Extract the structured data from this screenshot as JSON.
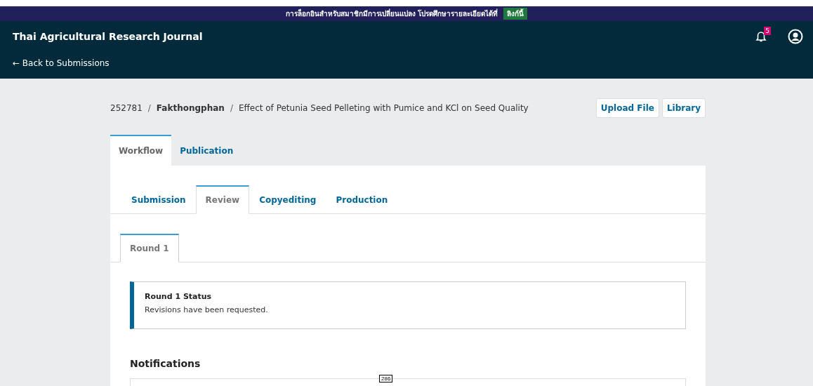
{
  "banner": {
    "text": "การล็อกอินสำหรับสมาชิกมีการเปลี่ยนแปลง โปรดศึกษารายละเอียดได้ที่",
    "link": "ลิงก์นี้"
  },
  "header": {
    "title": "Thai Agricultural Research Journal",
    "back_link": "← Back to Submissions",
    "notification_count": "5"
  },
  "breadcrumb": {
    "id": "252781",
    "separators": [
      "/",
      "/"
    ],
    "author": "Fakthongphan",
    "title": "Effect of Petunia Seed Pelleting with Pumice and KCl on Seed Quality"
  },
  "actions": [
    "Upload File",
    "Library"
  ],
  "tabs": [
    {
      "label": "Workflow",
      "selected": true
    },
    {
      "label": "Publication",
      "selected": false
    }
  ],
  "stage_tabs": [
    {
      "label": "Submission",
      "selected": false
    },
    {
      "label": "Review",
      "selected": true
    },
    {
      "label": "Copyediting",
      "selected": false
    },
    {
      "label": "Production",
      "selected": false
    }
  ],
  "round_tabs": [
    {
      "label": "Round 1",
      "selected": true
    }
  ],
  "status": {
    "title": "Round 1 Status",
    "message": "Revisions have been requested."
  },
  "notifications": {
    "heading": "Notifications",
    "page_label": "286"
  }
}
